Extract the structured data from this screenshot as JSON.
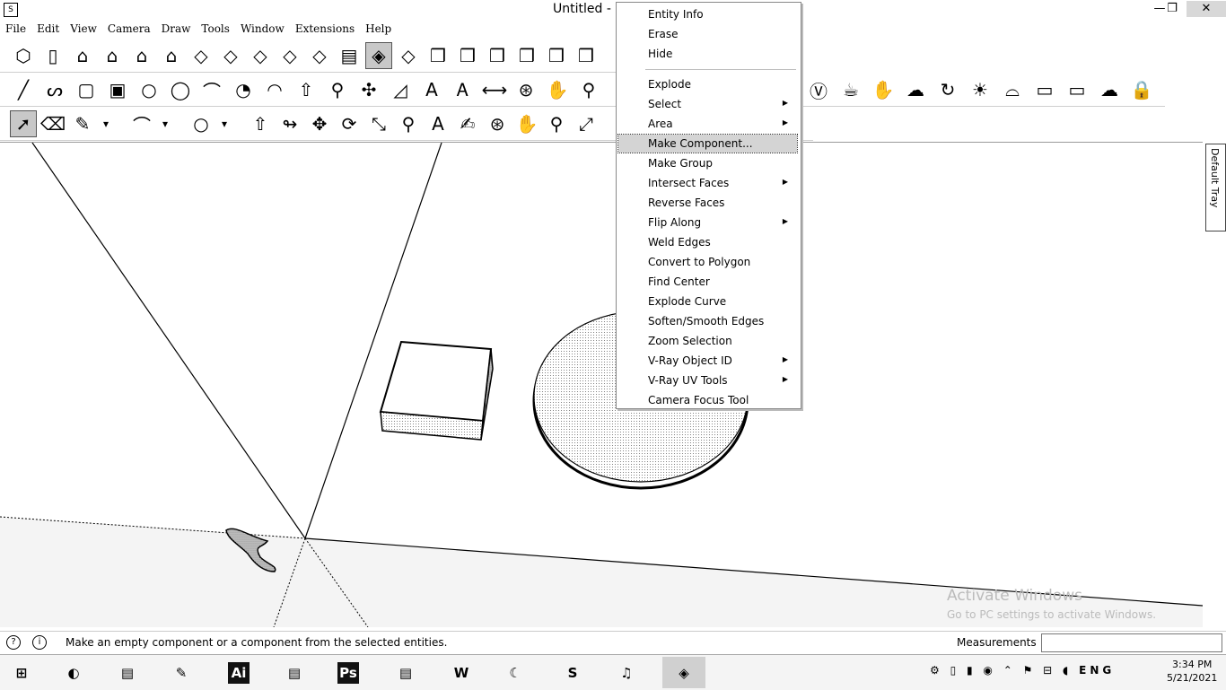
{
  "window": {
    "title": "Untitled - SketchUp",
    "app_icon": "sketchup-logo-icon",
    "controls": {
      "minimize": "—",
      "maximize": "❐",
      "close": "✕"
    }
  },
  "menubar": [
    "File",
    "Edit",
    "View",
    "Camera",
    "Draw",
    "Tools",
    "Window",
    "Extensions",
    "Help"
  ],
  "toolbars": {
    "row1": [
      "iso-view-icon",
      "top-view-icon",
      "home-icon",
      "front-view-icon",
      "house-icon",
      "back-view-icon",
      "section-icon",
      "section-2-icon",
      "xray-icon",
      "wireframe-icon",
      "hidden-line-icon",
      "shaded-icon",
      "textured-icon",
      "monochrome-icon",
      "component-icon",
      "component-2-icon",
      "component-3-icon",
      "component-4-icon",
      "component-5-icon",
      "component-6-icon"
    ],
    "row2": [
      "line-icon",
      "freehand-icon",
      "rectangle-icon",
      "rotated-rect-icon",
      "circle-icon",
      "polygon-icon",
      "arc-icon",
      "pie-icon",
      "arc-3pt-icon",
      "pushpull-icon",
      "tape-icon",
      "axes-icon",
      "protractor-icon",
      "text-icon",
      "3dtext-icon",
      "dimension-icon",
      "orbit-icon",
      "pan-icon",
      "zoom-icon"
    ],
    "row2_right": [
      "vray-icon",
      "teapot-icon",
      "render-icon",
      "cloud-icon",
      "refresh-icon",
      "lights-icon",
      "dome-icon",
      "frame-icon",
      "frame-2-icon",
      "cloud-2-icon",
      "lock-icon"
    ],
    "row3": [
      "select-icon",
      "eraser-icon",
      "pencil-icon",
      "dropdown-icon",
      "arc-icon",
      "dropdown-icon",
      "circle-icon",
      "dropdown-icon",
      "pushpull-icon",
      "followme-icon",
      "move-icon",
      "rotate-icon",
      "scale-icon",
      "tape-icon",
      "text-icon",
      "paint-icon",
      "orbit-icon",
      "pan-icon",
      "zoom-icon",
      "zoom-extents-icon"
    ]
  },
  "context_menu": {
    "items": [
      {
        "label": "Entity Info",
        "submenu": false
      },
      {
        "label": "Erase",
        "submenu": false
      },
      {
        "label": "Hide",
        "submenu": false
      },
      {
        "separator": true
      },
      {
        "label": "Explode",
        "submenu": false
      },
      {
        "label": "Select",
        "submenu": true
      },
      {
        "label": "Area",
        "submenu": true
      },
      {
        "label": "Make Component...",
        "submenu": false,
        "highlighted": true
      },
      {
        "label": "Make Group",
        "submenu": false
      },
      {
        "label": "Intersect Faces",
        "submenu": true
      },
      {
        "label": "Reverse Faces",
        "submenu": false
      },
      {
        "label": "Flip Along",
        "submenu": true
      },
      {
        "label": "Weld Edges",
        "submenu": false
      },
      {
        "label": "Convert to Polygon",
        "submenu": false
      },
      {
        "label": "Find Center",
        "submenu": false
      },
      {
        "label": "Explode Curve",
        "submenu": false
      },
      {
        "label": "Soften/Smooth Edges",
        "submenu": false
      },
      {
        "label": "Zoom Selection",
        "submenu": false
      },
      {
        "label": "V-Ray Object ID",
        "submenu": true
      },
      {
        "label": "V-Ray UV Tools",
        "submenu": true
      },
      {
        "label": "Camera Focus Tool",
        "submenu": false
      }
    ]
  },
  "tray": {
    "label": "Default Tray"
  },
  "watermark": {
    "title": "Activate Windows",
    "subtitle": "Go to PC settings to activate Windows."
  },
  "statusbar": {
    "message": "Make an empty component or a component from the selected entities.",
    "measurements_label": "Measurements",
    "measurements_value": ""
  },
  "taskbar": {
    "apps": [
      {
        "icon": "windows-start-icon",
        "glyph": "⊞"
      },
      {
        "icon": "chrome-icon",
        "glyph": "◐"
      },
      {
        "icon": "media-icon",
        "glyph": "▤"
      },
      {
        "icon": "notes-icon",
        "glyph": "✎"
      },
      {
        "icon": "illustrator-icon",
        "glyph": "Ai"
      },
      {
        "icon": "document-icon",
        "glyph": "▤"
      },
      {
        "icon": "photoshop-icon",
        "glyph": "Ps"
      },
      {
        "icon": "files-icon",
        "glyph": "▤"
      },
      {
        "icon": "word-icon",
        "glyph": "W"
      },
      {
        "icon": "moon-icon",
        "glyph": "☾"
      },
      {
        "icon": "skype-icon",
        "glyph": "S"
      },
      {
        "icon": "music-icon",
        "glyph": "♫"
      },
      {
        "icon": "sketchup-taskbar-icon",
        "glyph": "◈",
        "active": true
      }
    ],
    "clock_time": "3:34 PM",
    "clock_date": "5/21/2021",
    "tray_icons": "⚙ ▯ ▮ ◉ ⌃ ⚑ ⊟ ◖",
    "language": "ENG"
  }
}
